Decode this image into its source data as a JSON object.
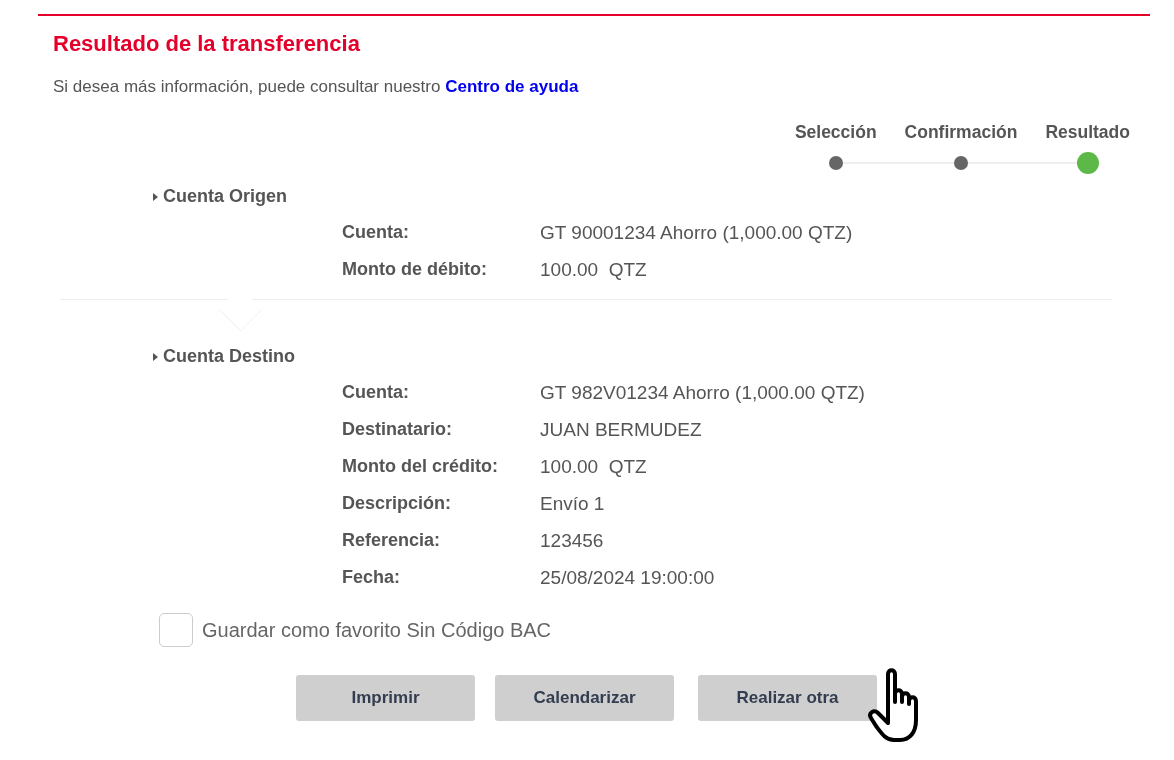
{
  "title": "Resultado de la transferencia",
  "help": {
    "text": "Si desea más información, puede consultar nuestro",
    "link": "Centro de ayuda"
  },
  "steps": [
    {
      "label": "Selección",
      "current": false
    },
    {
      "label": "Confirmación",
      "current": false
    },
    {
      "label": "Resultado",
      "current": true
    }
  ],
  "sections": [
    {
      "heading": "Cuenta Origen",
      "rows": [
        {
          "label": "Cuenta:",
          "value": "GT 90001234 Ahorro (1,000.00 QTZ)"
        },
        {
          "label": "Monto de débito:",
          "value": "100.00  QTZ"
        }
      ]
    },
    {
      "heading": "Cuenta Destino",
      "rows": [
        {
          "label": "Cuenta:",
          "value": "GT 982V01234 Ahorro (1,000.00 QTZ)"
        },
        {
          "label": "Destinatario:",
          "value": "JUAN BERMUDEZ"
        },
        {
          "label": "Monto del crédito:",
          "value": "100.00  QTZ"
        },
        {
          "label": "Descripción:",
          "value": "Envío 1"
        },
        {
          "label": "Referencia:",
          "value": "123456"
        },
        {
          "label": "Fecha:",
          "value": "25/08/2024 19:00:00"
        }
      ]
    }
  ],
  "favorite": {
    "label": "Guardar como favorito Sin Código BAC",
    "checked": false
  },
  "buttons": [
    "Imprimir",
    "Calendarizar",
    "Realizar otra"
  ]
}
